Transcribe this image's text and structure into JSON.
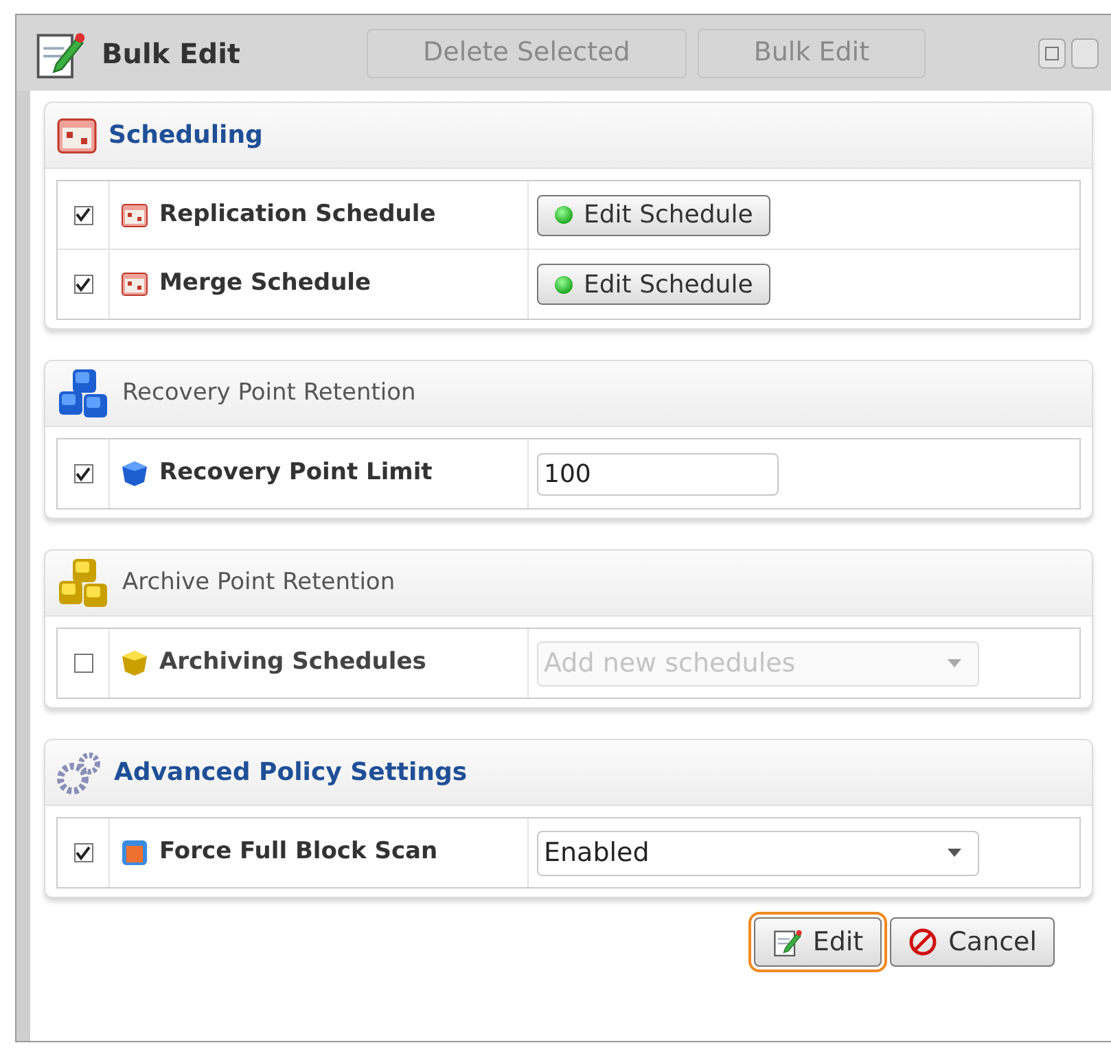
{
  "window": {
    "title": "Bulk Edit"
  },
  "background_toolbar": [
    "Delete Selected",
    "Bulk Edit"
  ],
  "sections": [
    {
      "title": "Scheduling",
      "kind": "primary",
      "rows": [
        {
          "checked": true,
          "label": "Replication Schedule",
          "kind": "button",
          "value": "Edit Schedule",
          "disabled": false
        },
        {
          "checked": true,
          "label": "Merge Schedule",
          "kind": "button",
          "value": "Edit Schedule",
          "disabled": false
        }
      ]
    },
    {
      "title": "Recovery Point Retention",
      "kind": "secondary",
      "rows": [
        {
          "checked": true,
          "label": "Recovery Point Limit",
          "kind": "input",
          "value": "100",
          "disabled": false
        }
      ]
    },
    {
      "title": "Archive Point Retention",
      "kind": "secondary",
      "rows": [
        {
          "checked": false,
          "label": "Archiving Schedules",
          "kind": "select",
          "placeholder": "Add new schedules",
          "disabled": true
        }
      ]
    },
    {
      "title": "Advanced Policy Settings",
      "kind": "primary",
      "rows": [
        {
          "checked": true,
          "label": "Force Full Block Scan",
          "kind": "select",
          "value": "Enabled",
          "disabled": false
        }
      ]
    }
  ],
  "buttons": [
    {
      "label": "Edit",
      "kind": "edit",
      "highlighted": true
    },
    {
      "label": "Cancel",
      "kind": "cancel",
      "highlighted": false
    }
  ]
}
